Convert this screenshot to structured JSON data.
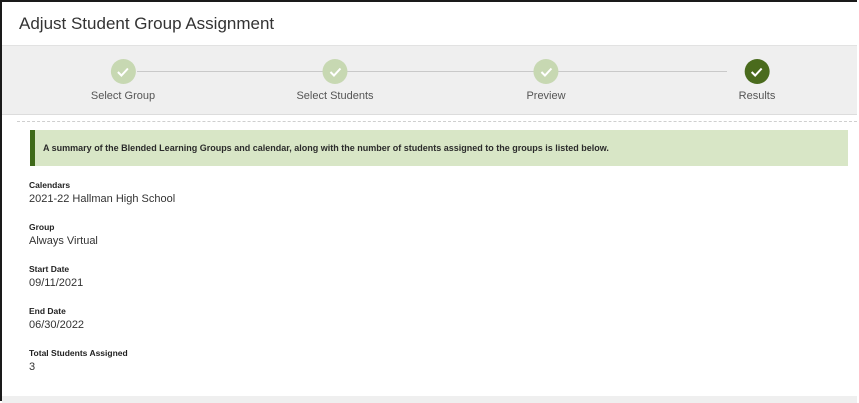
{
  "header": {
    "title": "Adjust Student Group Assignment"
  },
  "steps": [
    {
      "label": "Select Group",
      "icon": "check-icon"
    },
    {
      "label": "Select Students",
      "icon": "check-icon"
    },
    {
      "label": "Preview",
      "icon": "check-icon"
    },
    {
      "label": "Results",
      "icon": "check-icon"
    }
  ],
  "summary": {
    "text": "A summary of the Blended Learning Groups and calendar, along with the number of students assigned to the groups is listed below."
  },
  "fields": [
    {
      "label": "Calendars",
      "value": "2021-22 Hallman High School"
    },
    {
      "label": "Group",
      "value": "Always Virtual"
    },
    {
      "label": "Start Date",
      "value": "09/11/2021"
    },
    {
      "label": "End Date",
      "value": "06/30/2022"
    },
    {
      "label": "Total Students Assigned",
      "value": "3"
    }
  ],
  "colors": {
    "step_complete": "#c7d8b2",
    "step_active": "#4a6b1d",
    "summary_bg": "#d8e6c6",
    "summary_accent": "#3f6a1a"
  }
}
